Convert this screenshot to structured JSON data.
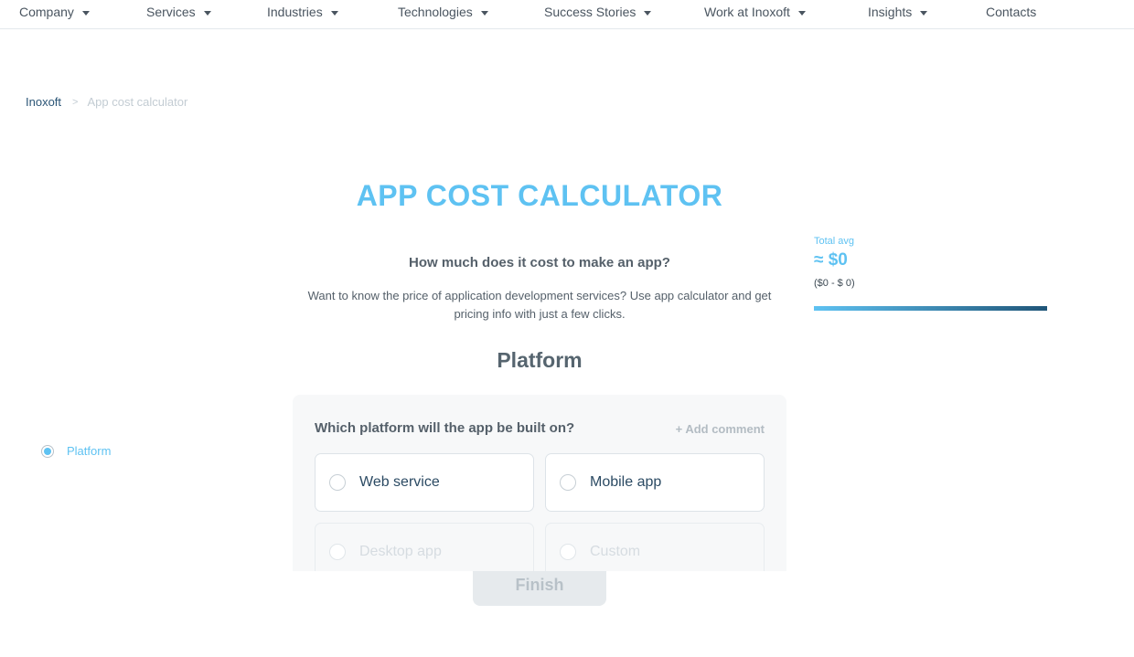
{
  "nav": {
    "items": [
      {
        "label": "Company",
        "has_dropdown": true
      },
      {
        "label": "Services",
        "has_dropdown": true
      },
      {
        "label": "Industries",
        "has_dropdown": true
      },
      {
        "label": "Technologies",
        "has_dropdown": true
      },
      {
        "label": "Success Stories",
        "has_dropdown": true
      },
      {
        "label": "Work at Inoxoft",
        "has_dropdown": true
      },
      {
        "label": "Insights",
        "has_dropdown": true
      },
      {
        "label": "Contacts",
        "has_dropdown": false
      }
    ]
  },
  "breadcrumb": {
    "home": "Inoxoft",
    "separator": ">",
    "current": "App cost calculator"
  },
  "page": {
    "title": "APP COST CALCULATOR",
    "subtitle": "How much does it cost to make an app?",
    "description": "Want to know the price of application development services? Use app calculator and get pricing info with just a few clicks.",
    "section_title": "Platform"
  },
  "total": {
    "label": "Total avg",
    "value": "≈ $0",
    "range": "($0 - $ 0)"
  },
  "steps": [
    {
      "label": "Platform",
      "active": true
    }
  ],
  "question": {
    "text": "Which platform will the app be built on?",
    "add_comment": "+ Add comment",
    "options": [
      {
        "label": "Web service",
        "selected": false
      },
      {
        "label": "Mobile app",
        "selected": false
      },
      {
        "label": "Desktop app",
        "selected": false
      },
      {
        "label": "Custom",
        "selected": false
      }
    ]
  },
  "finish_label": "Finish",
  "colors": {
    "accent": "#5ec2f2",
    "dark_blue": "#1f5578",
    "text": "#55606a"
  }
}
